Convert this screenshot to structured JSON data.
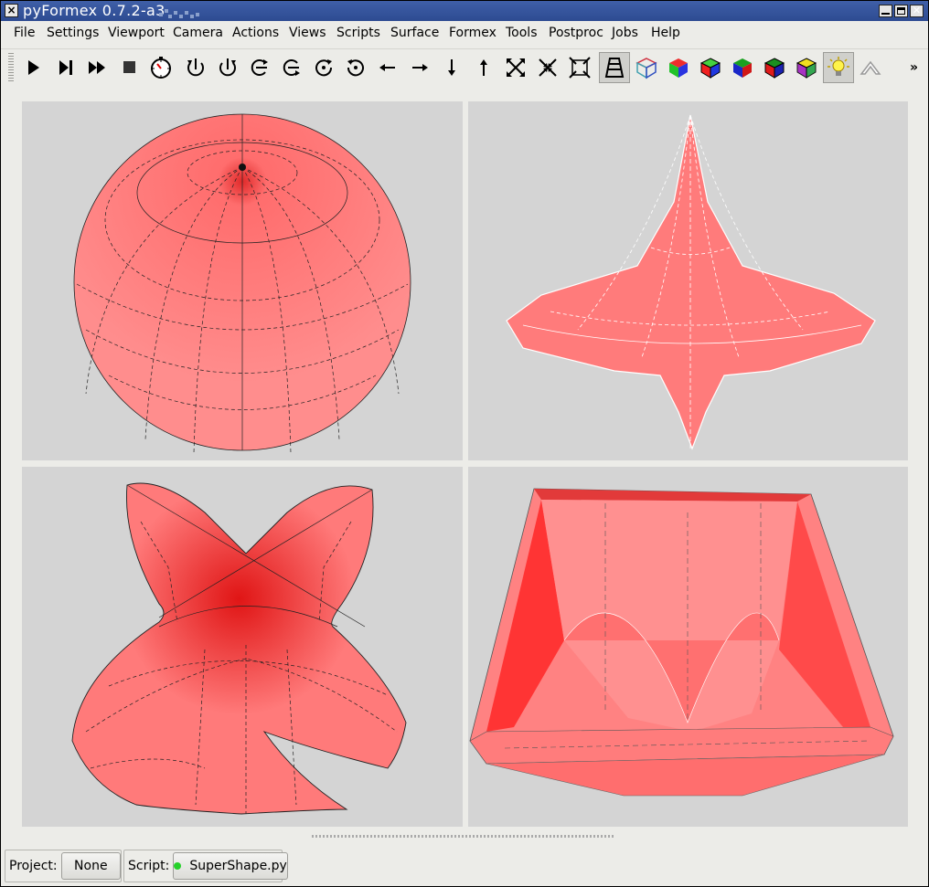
{
  "window": {
    "title": "pyFormex 0.7.2-a3",
    "title_color": "#2f4e93"
  },
  "menubar": {
    "items": [
      "File",
      "Settings",
      "Viewport",
      "Camera",
      "Actions",
      "Views",
      "Scripts",
      "Surface",
      "Formex",
      "Tools",
      "Postproc",
      "Jobs",
      "Help"
    ]
  },
  "toolbar": {
    "buttons": [
      {
        "name": "play-icon",
        "active": false
      },
      {
        "name": "step-icon",
        "active": false
      },
      {
        "name": "fast-forward-icon",
        "active": false
      },
      {
        "name": "stop-icon",
        "active": false
      },
      {
        "name": "timer-icon",
        "active": false
      },
      {
        "name": "rotate-left-icon",
        "active": false
      },
      {
        "name": "rotate-right-icon",
        "active": false
      },
      {
        "name": "rotate-up-icon",
        "active": false
      },
      {
        "name": "rotate-down-icon",
        "active": false
      },
      {
        "name": "twist-left-icon",
        "active": false
      },
      {
        "name": "twist-right-icon",
        "active": false
      },
      {
        "name": "pan-left-icon",
        "active": false
      },
      {
        "name": "pan-right-icon",
        "active": false
      },
      {
        "name": "pan-down-icon",
        "active": false
      },
      {
        "name": "pan-up-icon",
        "active": false
      },
      {
        "name": "zoom-out-icon",
        "active": false
      },
      {
        "name": "zoom-in-icon",
        "active": false
      },
      {
        "name": "zoom-all-icon",
        "active": false
      },
      {
        "name": "perspective-icon",
        "active": true
      },
      {
        "name": "wireframe-icon",
        "active": false
      },
      {
        "name": "smooth-icon",
        "active": false
      },
      {
        "name": "smoothwire-icon",
        "active": false
      },
      {
        "name": "flat-icon",
        "active": false
      },
      {
        "name": "flatwire-icon",
        "active": false
      },
      {
        "name": "transparency-icon",
        "active": false
      },
      {
        "name": "light-icon",
        "active": true
      },
      {
        "name": "shrink-icon",
        "active": false
      }
    ],
    "extension": "»"
  },
  "viewports": {
    "background": "#d4d4d4",
    "surface_color": "#ff6b6b"
  },
  "status": {
    "project_label": "Project:",
    "project_value": "None",
    "script_label": "Script:",
    "script_value": "SuperShape.py",
    "script_status_color": "#26d12a"
  }
}
